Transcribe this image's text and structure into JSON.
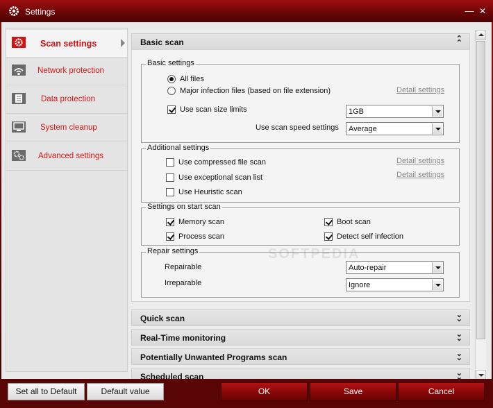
{
  "window": {
    "title": "Settings"
  },
  "sidebar": {
    "items": [
      {
        "label": "Scan settings",
        "icon": "gear-icon",
        "active": true
      },
      {
        "label": "Network protection",
        "icon": "network-icon",
        "active": false
      },
      {
        "label": "Data protection",
        "icon": "document-icon",
        "active": false
      },
      {
        "label": "System cleanup",
        "icon": "monitor-icon",
        "active": false
      },
      {
        "label": "Advanced settings",
        "icon": "gears-icon",
        "active": false
      }
    ]
  },
  "basic_scan": {
    "header": "Basic scan",
    "basic_settings": {
      "legend": "Basic settings",
      "all_files": "All files",
      "major_infection": "Major infection files (based on file extension)",
      "detail_link": "Detail settings",
      "size_limits": "Use scan size limits",
      "size_value": "1GB",
      "speed_label": "Use scan speed settings",
      "speed_value": "Average"
    },
    "additional_settings": {
      "legend": "Additional settings",
      "compressed": "Use compressed file scan",
      "exceptional": "Use exceptional scan list",
      "heuristic": "Use Heuristic scan",
      "detail_link_1": "Detail settings",
      "detail_link_2": "Detail settings"
    },
    "start_scan": {
      "legend": "Settings on start scan",
      "memory": "Memory scan",
      "process": "Process scan",
      "boot": "Boot scan",
      "self_infection": "Detect self infection"
    },
    "repair_settings": {
      "legend": "Repair settings",
      "repairable_label": "Repairable",
      "repairable_value": "Auto-repair",
      "irreparable_label": "Irreparable",
      "irreparable_value": "Ignore"
    }
  },
  "collapsed_sections": [
    "Quick scan",
    "Real-Time monitoring",
    "Potentially Unwanted Programs scan",
    "Scheduled scan"
  ],
  "watermark": "SOFTPEDIA",
  "buttons": {
    "set_all_default": "Set all to Default",
    "default_value": "Default value",
    "ok": "OK",
    "save": "Save",
    "cancel": "Cancel"
  },
  "colors": {
    "accent": "#d61616",
    "frame": "#8a0b0b"
  }
}
